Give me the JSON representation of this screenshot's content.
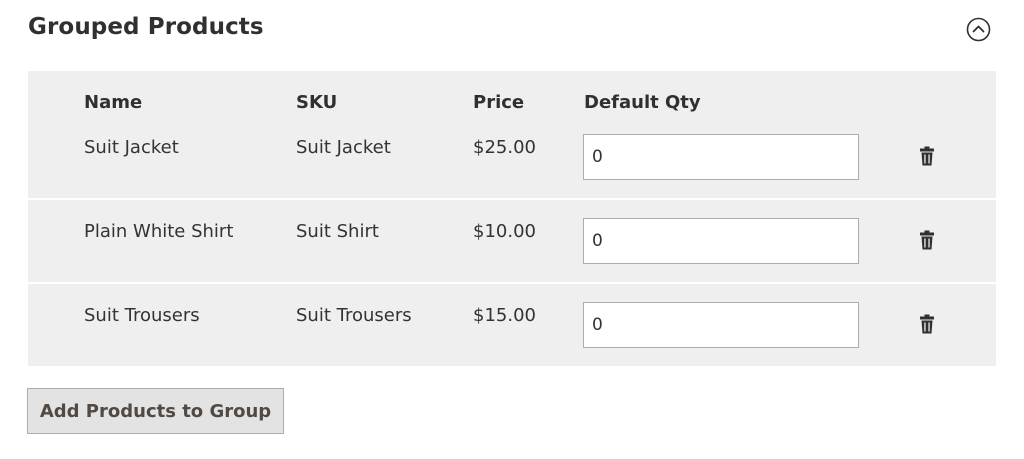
{
  "section": {
    "title": "Grouped Products",
    "toggle_icon": "chevron-up-circle-icon"
  },
  "grid": {
    "columns": {
      "name": "Name",
      "sku": "SKU",
      "price": "Price",
      "default_qty": "Default Qty"
    },
    "rows": [
      {
        "name": "Suit Jacket",
        "sku": "Suit Jacket",
        "price": "$25.00",
        "default_qty": "0"
      },
      {
        "name": "Plain White Shirt",
        "sku": "Suit Shirt",
        "price": "$10.00",
        "default_qty": "0"
      },
      {
        "name": "Suit Trousers",
        "sku": "Suit Trousers",
        "price": "$15.00",
        "default_qty": "0"
      }
    ],
    "delete_icon": "trash-icon"
  },
  "actions": {
    "add_label": "Add Products to Group"
  },
  "colors": {
    "grid_background": "#efefef",
    "button_background": "#e3e3e3",
    "text": "#333333"
  }
}
